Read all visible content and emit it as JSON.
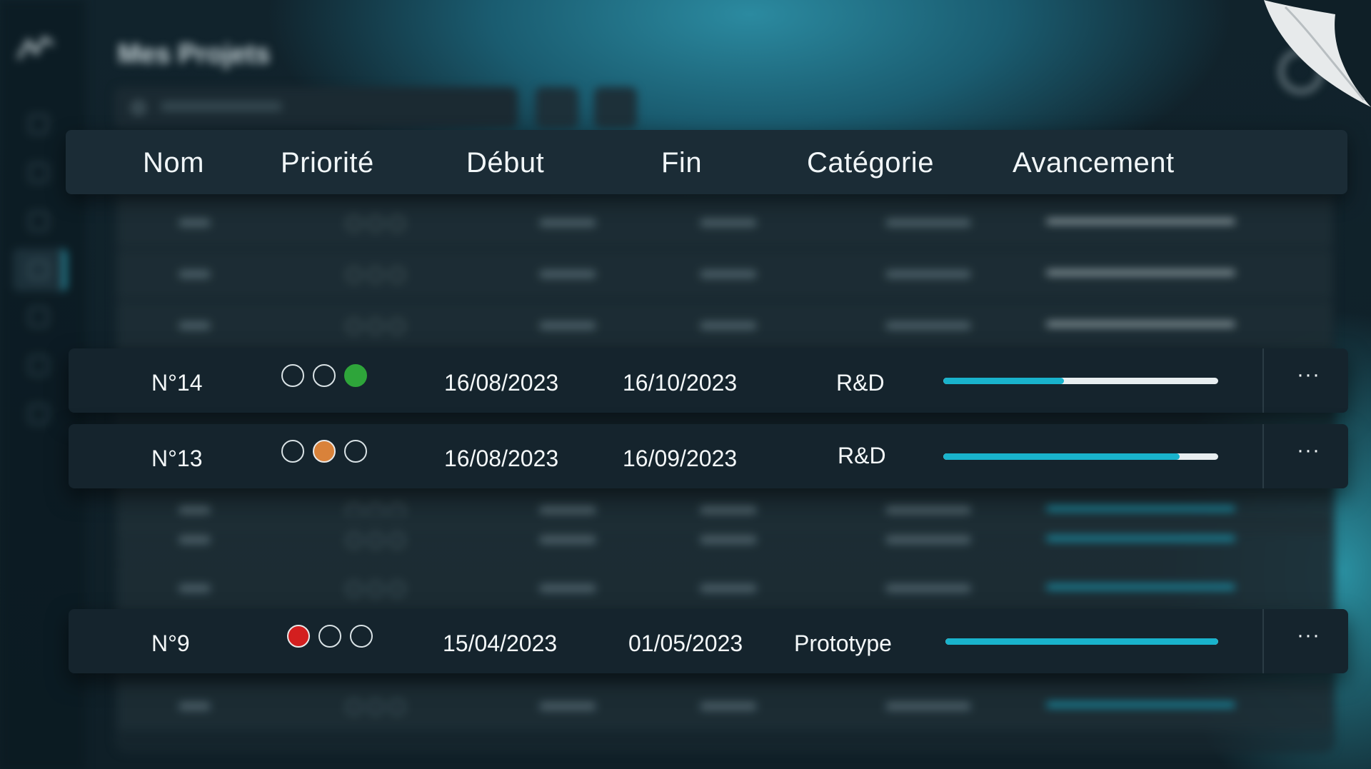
{
  "app": {
    "title": "Mes Projets"
  },
  "table": {
    "columns": [
      "Nom",
      "Priorité",
      "Début",
      "Fin",
      "Catégorie",
      "Avancement"
    ],
    "rows": [
      {
        "name": "N°14",
        "priority": 3,
        "priority_color": "#2ea53a",
        "start": "16/08/2023",
        "end": "16/10/2023",
        "category": "R&D",
        "progress": 0.44,
        "menu": "···"
      },
      {
        "name": "N°13",
        "priority": 2,
        "priority_color": "#d9823a",
        "start": "16/08/2023",
        "end": "16/09/2023",
        "category": "R&D",
        "progress": 0.86,
        "menu": "···"
      },
      {
        "name": "N°9",
        "priority": 1,
        "priority_color": "#d31f1f",
        "start": "15/04/2023",
        "end": "01/05/2023",
        "category": "Prototype",
        "progress": 1.0,
        "menu": "···"
      }
    ]
  },
  "colors": {
    "accent": "#19b3cc",
    "background": "#11232c",
    "card": "#15242d"
  }
}
